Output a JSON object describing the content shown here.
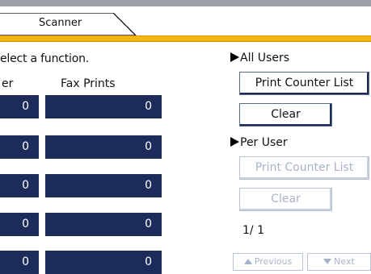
{
  "tabs": [
    {
      "label": "Scanner"
    }
  ],
  "instruction": "elect a function.",
  "columns": {
    "left_header_partial": "er",
    "fax_prints_header": "Fax Prints"
  },
  "counters": [
    {
      "left": "0",
      "fax": "0"
    },
    {
      "left": "0",
      "fax": "0"
    },
    {
      "left": "0",
      "fax": "0"
    },
    {
      "left": "0",
      "fax": "0"
    },
    {
      "left": "0",
      "fax": "0"
    }
  ],
  "all_users": {
    "label": "All Users",
    "print_counter_list": "Print Counter List",
    "clear": "Clear"
  },
  "per_user": {
    "label": "Per User",
    "print_counter_list": "Print Counter List",
    "clear": "Clear"
  },
  "pagination": {
    "indicator": "1/  1",
    "previous": "Previous",
    "next": "Next"
  },
  "colors": {
    "accent": "#f6b40e",
    "counter_bg": "#1c2b5a",
    "disabled_text": "#a8b3c8"
  }
}
